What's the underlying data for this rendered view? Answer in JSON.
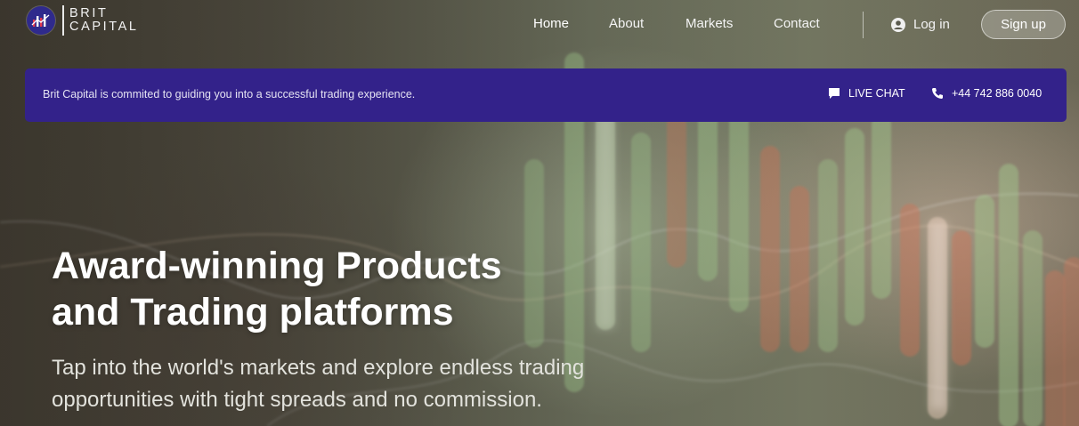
{
  "brand": {
    "line1": "BRIT",
    "line2": "CAPITAL",
    "logo_icon": "chart-bars-icon",
    "accent": "#33228a"
  },
  "nav": {
    "items": [
      {
        "label": "Home",
        "active": true
      },
      {
        "label": "About",
        "active": false
      },
      {
        "label": "Markets",
        "active": false
      },
      {
        "label": "Contact",
        "active": false
      }
    ],
    "login_label": "Log in",
    "login_icon": "user-circle-icon",
    "signup_label": "Sign up"
  },
  "announcement": {
    "message": "Brit Capital is commited to guiding you into a successful trading experience.",
    "live_chat_label": "LIVE CHAT",
    "live_chat_icon": "chat-bubble-icon",
    "phone": "+44 742 886 0040",
    "phone_icon": "phone-icon"
  },
  "hero": {
    "title_line1": "Award-winning Products",
    "title_line2": "and Trading platforms",
    "subtitle_line1": "Tap into the world's markets and explore endless trading",
    "subtitle_line2": "opportunities with tight spreads and no commission."
  }
}
